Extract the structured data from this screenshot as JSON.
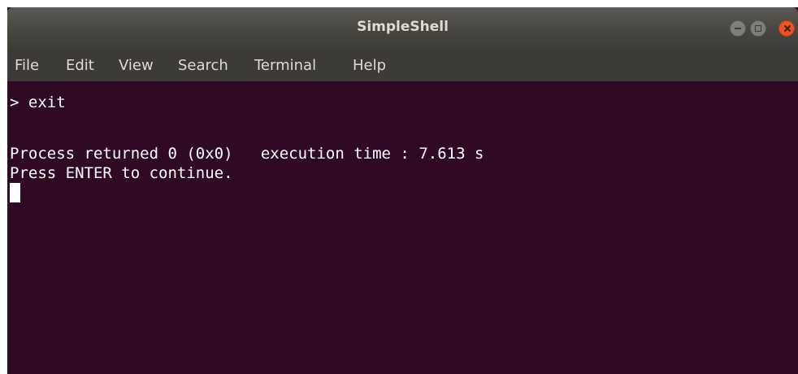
{
  "window": {
    "title": "SimpleShell",
    "background_color": "#300a24",
    "controls": {
      "minimize_icon": "minimize-icon",
      "maximize_icon": "maximize-icon",
      "close_icon": "close-icon",
      "close_color": "#e95420"
    }
  },
  "menu": {
    "items": [
      "File",
      "Edit",
      "View",
      "Search",
      "Terminal",
      "Help"
    ]
  },
  "terminal": {
    "lines": [
      "> exit",
      "",
      "Process returned 0 (0x0)   execution time : 7.613 s",
      "Press ENTER to continue."
    ],
    "cursor": "block-cursor"
  }
}
